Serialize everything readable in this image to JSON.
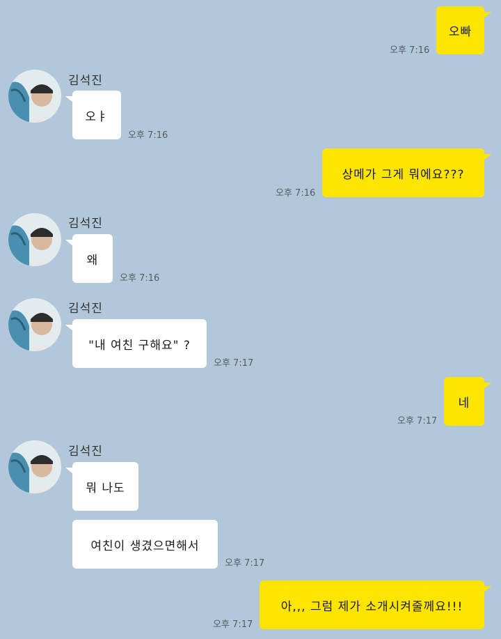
{
  "contact": {
    "name": "김석진"
  },
  "messages": [
    {
      "id": 1,
      "sender": "me",
      "text": "오빠",
      "time": "오후 7:16"
    },
    {
      "id": 2,
      "sender": "other",
      "text": "오ㅑ",
      "time": "오후 7:16"
    },
    {
      "id": 3,
      "sender": "me",
      "text": "상메가 그게 뭐에요???",
      "time": "오후 7:16"
    },
    {
      "id": 4,
      "sender": "other",
      "text": "왜",
      "time": "오후 7:16"
    },
    {
      "id": 5,
      "sender": "other",
      "text": "\"내 여친 구해요\" ?",
      "time": "오후 7:17"
    },
    {
      "id": 6,
      "sender": "me",
      "text": "네",
      "time": "오후 7:17"
    },
    {
      "id": 7,
      "sender": "other",
      "text": "뭐 나도",
      "time": ""
    },
    {
      "id": 8,
      "sender": "other",
      "text": "여친이 생겼으면해서",
      "time": "오후 7:17"
    },
    {
      "id": 9,
      "sender": "me",
      "text": "아,,, 그럼 제가 소개시켜줄께요!!!",
      "time": "오후 7:17"
    }
  ],
  "colors": {
    "background": "#b2c7da",
    "my_bubble": "#fee500",
    "their_bubble": "#ffffff"
  }
}
